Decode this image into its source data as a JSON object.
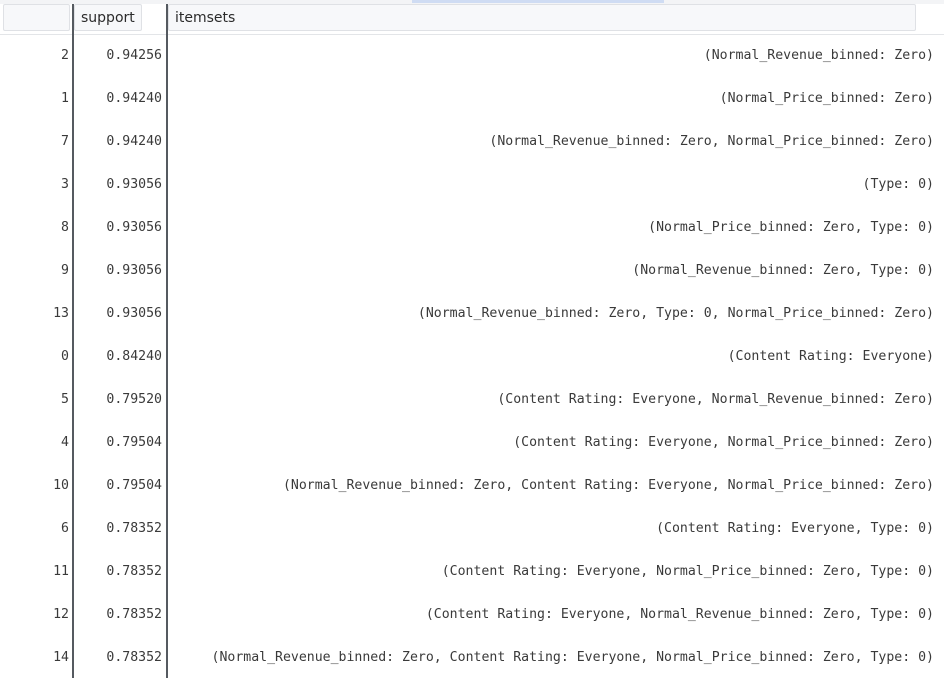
{
  "table": {
    "columns": {
      "index": "",
      "support": "support",
      "itemsets": "itemsets"
    },
    "rows": [
      {
        "index": "2",
        "support": "0.94256",
        "itemsets": "(Normal_Revenue_binned: Zero)"
      },
      {
        "index": "1",
        "support": "0.94240",
        "itemsets": "(Normal_Price_binned: Zero)"
      },
      {
        "index": "7",
        "support": "0.94240",
        "itemsets": "(Normal_Revenue_binned: Zero, Normal_Price_binned: Zero)"
      },
      {
        "index": "3",
        "support": "0.93056",
        "itemsets": "(Type: 0)"
      },
      {
        "index": "8",
        "support": "0.93056",
        "itemsets": "(Normal_Price_binned: Zero, Type: 0)"
      },
      {
        "index": "9",
        "support": "0.93056",
        "itemsets": "(Normal_Revenue_binned: Zero, Type: 0)"
      },
      {
        "index": "13",
        "support": "0.93056",
        "itemsets": "(Normal_Revenue_binned: Zero, Type: 0, Normal_Price_binned: Zero)"
      },
      {
        "index": "0",
        "support": "0.84240",
        "itemsets": "(Content Rating: Everyone)"
      },
      {
        "index": "5",
        "support": "0.79520",
        "itemsets": "(Content Rating: Everyone, Normal_Revenue_binned: Zero)"
      },
      {
        "index": "4",
        "support": "0.79504",
        "itemsets": "(Content Rating: Everyone, Normal_Price_binned: Zero)"
      },
      {
        "index": "10",
        "support": "0.79504",
        "itemsets": "(Normal_Revenue_binned: Zero, Content Rating: Everyone, Normal_Price_binned: Zero)"
      },
      {
        "index": "6",
        "support": "0.78352",
        "itemsets": "(Content Rating: Everyone, Type: 0)"
      },
      {
        "index": "11",
        "support": "0.78352",
        "itemsets": "(Content Rating: Everyone, Normal_Price_binned: Zero, Type: 0)"
      },
      {
        "index": "12",
        "support": "0.78352",
        "itemsets": "(Content Rating: Everyone, Normal_Revenue_binned: Zero, Type: 0)"
      },
      {
        "index": "14",
        "support": "0.78352",
        "itemsets": "(Normal_Revenue_binned: Zero, Content Rating: Everyone, Normal_Price_binned: Zero, Type: 0)"
      }
    ]
  }
}
